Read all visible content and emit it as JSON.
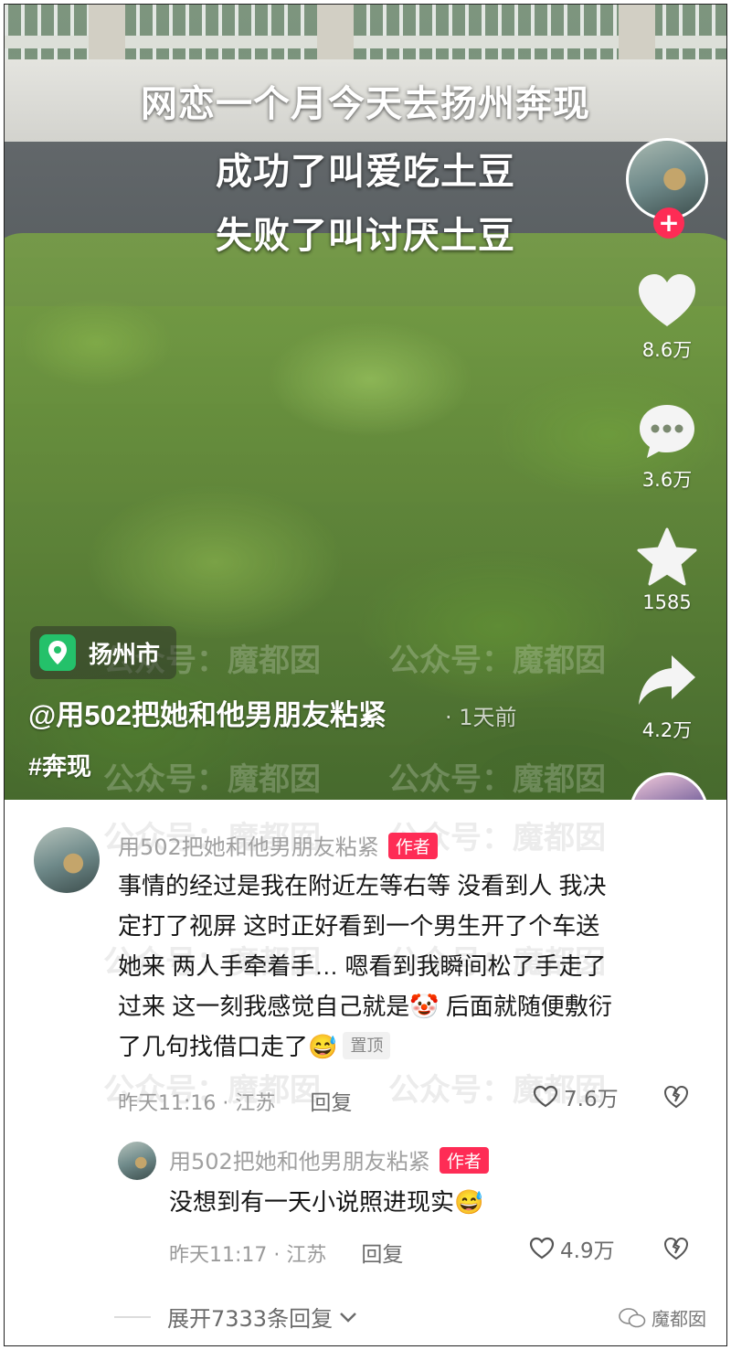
{
  "video": {
    "caption_lines": [
      "网恋一个月今天去扬州奔现",
      "成功了叫爱吃土豆",
      "失败了叫讨厌土豆"
    ],
    "location": "扬州市",
    "author": "@用502把她和他男朋友粘紧",
    "time_ago": "· 1天前",
    "hashtag": "#奔现"
  },
  "rail": {
    "like_count": "8.6万",
    "comment_count": "3.6万",
    "favorite_count": "1585",
    "share_count": "4.2万",
    "follow_symbol": "+"
  },
  "watermark": {
    "text_a": "公众号：",
    "text_b": "魔都囡"
  },
  "comments": [
    {
      "name": "用502把她和他男朋友粘紧",
      "author_tag": "作者",
      "lines": [
        "事情的经过是我在附近左等右等 没看到人 我决",
        "定打了视屏 这时正好看到一个男生开了个车送",
        "她来 两人手牵着手… 嗯看到我瞬间松了手走了",
        "过来 这一刻我感觉自己就是🤡 后面就随便敷衍",
        "了几句找借口走了😅"
      ],
      "pin_tag": "置顶",
      "time": "昨天11:16 · 江苏",
      "reply": "回复",
      "likes": "7.6万"
    },
    {
      "name": "用502把她和他男朋友粘紧",
      "author_tag": "作者",
      "text": "没想到有一天小说照进现实😅",
      "time": "昨天11:17 · 江苏",
      "reply": "回复",
      "likes": "4.9万"
    }
  ],
  "expand_replies": "展开7333条回复",
  "brand": "魔都囡",
  "colors": {
    "accent": "#fe2c55",
    "location_green": "#24c16a",
    "meta_gray": "#9a9a9a"
  }
}
